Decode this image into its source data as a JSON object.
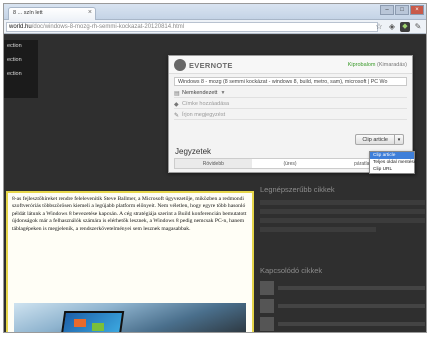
{
  "browser": {
    "tab_title": "8 ... szín lett",
    "tab_close": "×",
    "url_domain": "world.hu",
    "url_path": "/doc/windows-8-mozg-rh-semmi-kockazat-20120814.html",
    "window_buttons": [
      "–",
      "□",
      "×"
    ],
    "toolbar_icons": [
      "star-icon",
      "extension-icon",
      "evernote-icon",
      "wrench-icon"
    ]
  },
  "left_nav": {
    "items": [
      "ection",
      "ection",
      "ection"
    ]
  },
  "evernote": {
    "brand": "EVERNOTE",
    "user_link": "Kiprobalom",
    "user_suffix": "(Kimaradás)",
    "title_field": "Windows 8 - mozg (8 semmi kockázat - windows 8, build, metro, sam), microsoft | PC Wo",
    "notebook": "Nemkendezett",
    "tags_placeholder": "Címke hozzáadása",
    "comment_placeholder": "Írjon megjegyzést",
    "clip_button": "Clip article",
    "clip_arrow": "▾",
    "notes_heading": "Jegyzetek",
    "notes_tabs": [
      "Rövidebb",
      "(üres)",
      "páratlan.hu"
    ],
    "menu_items": [
      "Clip article",
      "Teljes oldal mentése",
      "Clip URL"
    ]
  },
  "article": {
    "text": "8-as fejlesztőhíreket rendre felelevenítik Steve Ballmer, a Microsoft ügyvezetője, miközben a redmondi szoftveróriás többszörösen kiemeli a legújabb platform előnyeit. Nem véletlen, hogy egyre több hasonló példát látunk a Windows 8 bevezetése kapcsán. A cég stratégiája szerint a Build konferencián bemutatott újdonságok már a felhasználók számára is elérhetők lesznek, a Windows 8 pedig nemcsak PC-n, hanem táblagépeken is megjelenik, a rendszerkövetelményei sem lesznek magasabbak."
  },
  "sidebar": {
    "title1": "Legnépszerűbb cikkek",
    "title2": "Kapcsolódó cikkek"
  }
}
